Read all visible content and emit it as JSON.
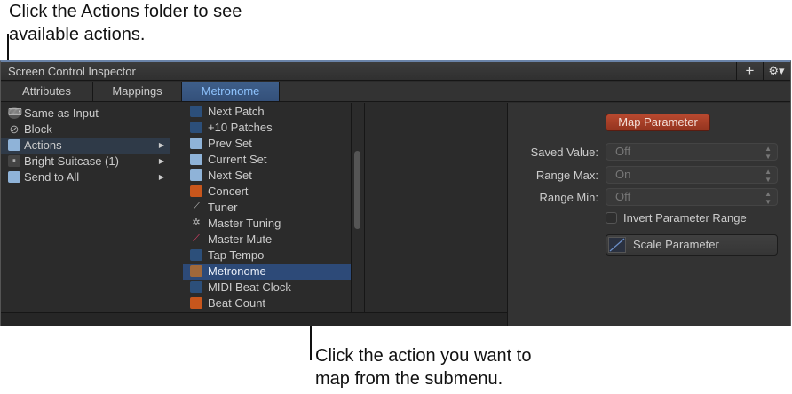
{
  "callouts": {
    "top_line1": "Click the Actions folder to see",
    "top_line2": "available actions.",
    "bottom_line1": "Click the action you want to",
    "bottom_line2": "map from the submenu."
  },
  "window": {
    "title": "Screen Control Inspector",
    "add_label": "+",
    "gear_label": "⚙▾"
  },
  "tabs": [
    {
      "label": "Attributes"
    },
    {
      "label": "Mappings"
    },
    {
      "label": "Metronome"
    }
  ],
  "left_list": [
    {
      "label": "Same as Input",
      "icon": "keyboard-icon",
      "glyph": "⌨"
    },
    {
      "label": "Block",
      "icon": "block-icon",
      "glyph": "⊘"
    },
    {
      "label": "Actions",
      "icon": "folder-icon",
      "glyph": ""
    },
    {
      "label": "Bright Suitcase (1)",
      "icon": "device-icon",
      "glyph": "▪"
    },
    {
      "label": "Send to All",
      "icon": "folder-midi-icon",
      "glyph": ""
    }
  ],
  "actions_list": [
    {
      "label": "Next Patch",
      "icon": "next-patch-icon"
    },
    {
      "label": "+10 Patches",
      "icon": "plus-ten-patches-icon"
    },
    {
      "label": "Prev Set",
      "icon": "prev-set-icon"
    },
    {
      "label": "Current Set",
      "icon": "current-set-icon"
    },
    {
      "label": "Next Set",
      "icon": "next-set-icon"
    },
    {
      "label": "Concert",
      "icon": "concert-icon"
    },
    {
      "label": "Tuner",
      "icon": "tuner-icon"
    },
    {
      "label": "Master Tuning",
      "icon": "master-tuning-icon"
    },
    {
      "label": "Master Mute",
      "icon": "master-mute-icon"
    },
    {
      "label": "Tap Tempo",
      "icon": "tap-tempo-icon"
    },
    {
      "label": "Metronome",
      "icon": "metronome-icon"
    },
    {
      "label": "MIDI Beat Clock",
      "icon": "midi-beat-clock-icon"
    },
    {
      "label": "Beat Count",
      "icon": "beat-count-icon"
    }
  ],
  "inspector": {
    "map_button": "Map Parameter",
    "saved_value_label": "Saved Value:",
    "saved_value": "Off",
    "range_max_label": "Range Max:",
    "range_max": "On",
    "range_min_label": "Range Min:",
    "range_min": "Off",
    "invert_label": "Invert Parameter Range",
    "scale_button": "Scale Parameter"
  }
}
